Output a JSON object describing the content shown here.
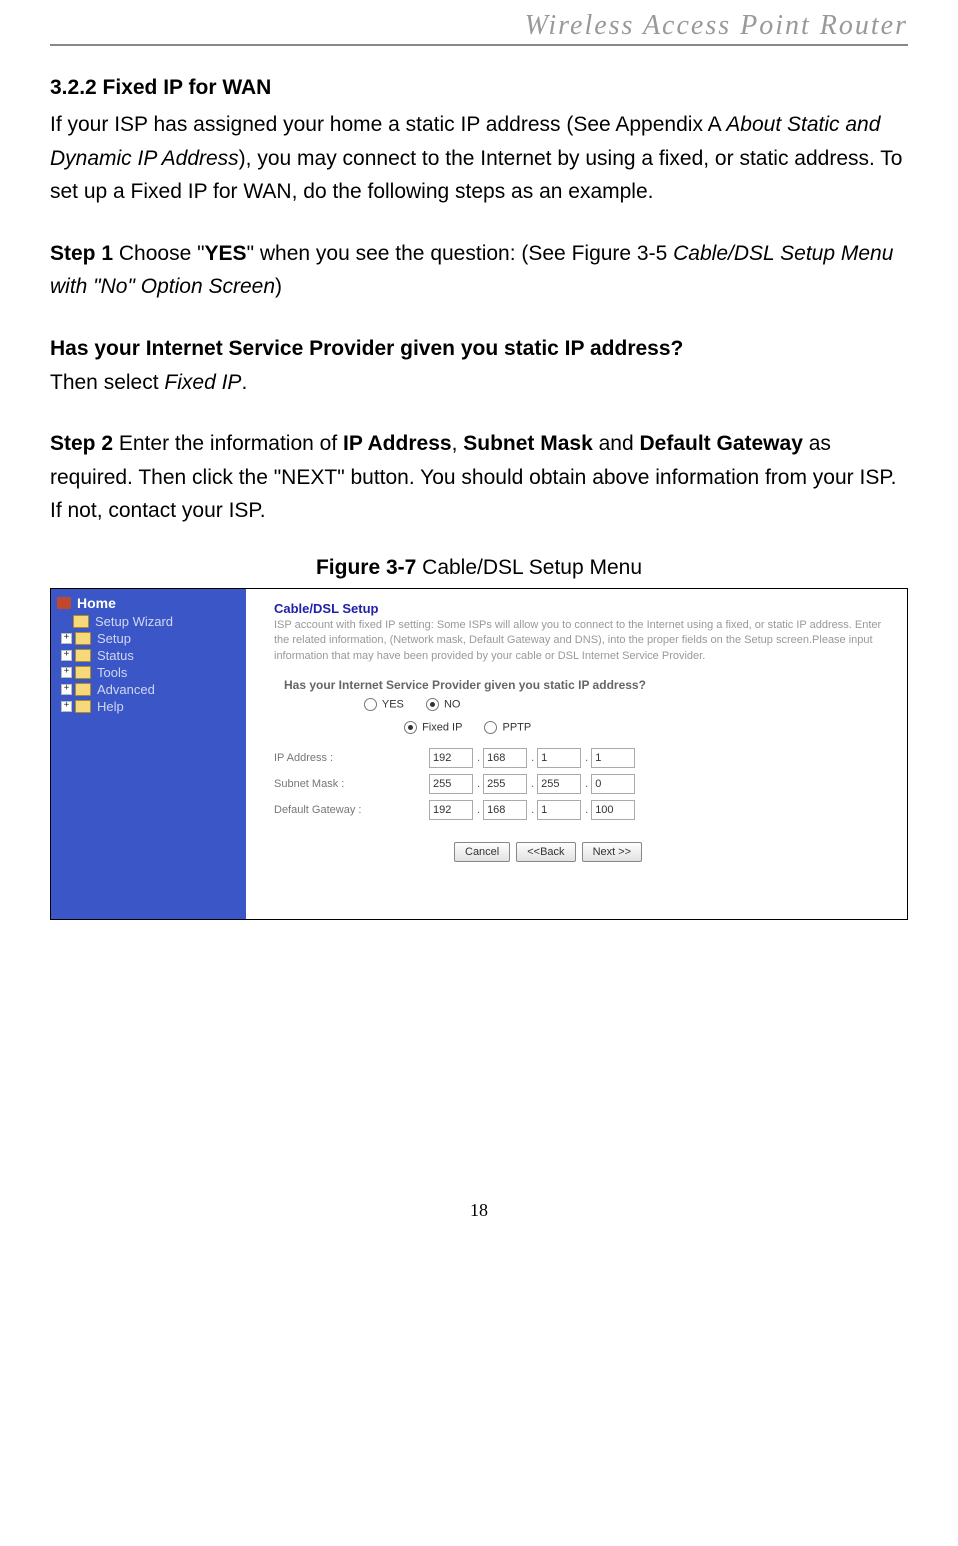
{
  "header": {
    "title": "Wireless  Access  Point  Router"
  },
  "section": {
    "heading": "3.2.2 Fixed IP for WAN",
    "para1_part1": "If your ISP has assigned your home a static IP address (See Appendix A ",
    "para1_italic": "About Static and Dynamic IP Address",
    "para1_part2": "), you may connect to the Internet by using a fixed, or static address. To set up a Fixed IP for WAN, do the following steps as an example.",
    "step1_label": "Step 1",
    "step1_text1": " Choose \"",
    "step1_yes": "YES",
    "step1_text2": "\" when you see the question: (See Figure 3-5 ",
    "step1_italic": "Cable/DSL Setup Menu with \"No\" Option Screen",
    "step1_text3": ")",
    "question": "Has your Internet Service Provider given you static IP address?",
    "then_select_text": "Then select ",
    "then_select_italic": "Fixed IP",
    "then_select_dot": ".",
    "step2_label": "Step 2",
    "step2_text1": " Enter the information of ",
    "step2_b1": "IP Address",
    "step2_c1": ", ",
    "step2_b2": "Subnet Mask",
    "step2_c2": " and ",
    "step2_b3": "Default Gateway",
    "step2_text2": " as required. Then click the \"NEXT\" button. You should obtain above information from your ISP. If not, contact your ISP.",
    "figure_label": "Figure 3-7",
    "figure_caption": " Cable/DSL Setup Menu"
  },
  "screenshot": {
    "sidebar": {
      "home": "Home",
      "items": [
        "Setup Wizard",
        "Setup",
        "Status",
        "Tools",
        "Advanced",
        "Help"
      ]
    },
    "panel_title": "Cable/DSL Setup",
    "panel_desc": "ISP account with fixed IP setting: Some ISPs will allow you to connect to the Internet using a fixed, or static IP address. Enter the related information, (Network mask, Default Gateway and DNS), into the proper fields on the Setup screen.Please input information that may have been provided by your cable or DSL Internet Service Provider.",
    "question": "Has your Internet Service Provider given you static IP address?",
    "yes_label": "YES",
    "no_label": "NO",
    "fixed_ip_label": "Fixed IP",
    "pptp_label": "PPTP",
    "rows": {
      "ip_label": "IP Address :",
      "ip": [
        "192",
        "168",
        "1",
        "1"
      ],
      "mask_label": "Subnet Mask :",
      "mask": [
        "255",
        "255",
        "255",
        "0"
      ],
      "gw_label": "Default Gateway :",
      "gw": [
        "192",
        "168",
        "1",
        "100"
      ]
    },
    "buttons": {
      "cancel": "Cancel",
      "back": "<<Back",
      "next": "Next >>"
    }
  },
  "page_number": "18"
}
